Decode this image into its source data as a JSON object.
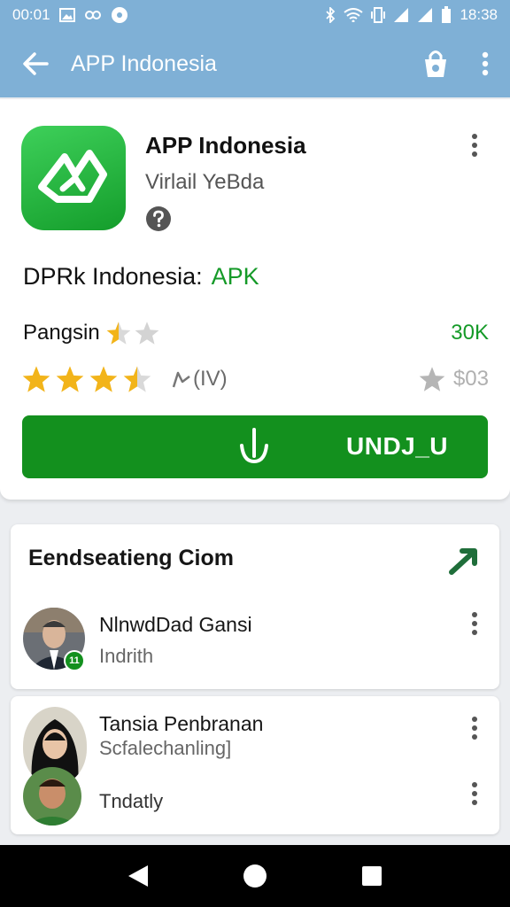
{
  "status_bar": {
    "time_left": "00:01",
    "time_right": "18:38"
  },
  "app_bar": {
    "title": "APP Indonesia",
    "icons": [
      "back-arrow-icon",
      "shopping-bag-icon",
      "more-vert-icon"
    ]
  },
  "app_card": {
    "name": "APP Indonesia",
    "developer": "Virlail YeBda",
    "apk_label": "DPRk Indonesia:",
    "apk_tag": "APK",
    "rating_label": "Pangsin",
    "downloads": "30K",
    "rating_value": 3.5,
    "reviews": "(IV)",
    "size": "$03",
    "install_label": "UNDJ_U",
    "accent_color": "#13901e",
    "icons": [
      "app-logo-icon",
      "help-icon",
      "star-icon",
      "thumb-icon",
      "download-icon"
    ]
  },
  "section": {
    "title": "Eendseatieng Ciom",
    "people": [
      {
        "name": "NlnwdDad Gansi",
        "subtitle": "Indrith",
        "badge": "11"
      },
      {
        "name": "Tansia Penbranan",
        "subtitle": "Scfalechanling]",
        "extra": "Tndatly"
      }
    ]
  },
  "nav_bar": {
    "icons": [
      "nav-back-icon",
      "nav-home-icon",
      "nav-recents-icon"
    ]
  }
}
